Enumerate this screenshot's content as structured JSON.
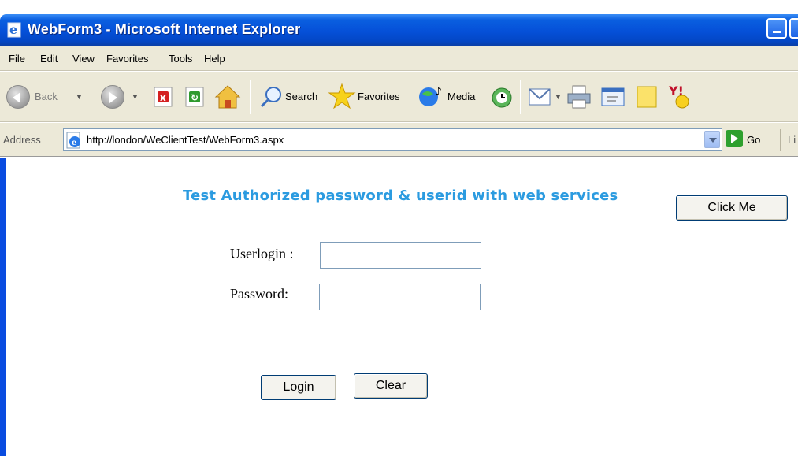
{
  "window": {
    "title": "WebForm3 - Microsoft Internet Explorer"
  },
  "menu": [
    "File",
    "Edit",
    "View",
    "Favorites",
    "Tools",
    "Help"
  ],
  "toolbar": {
    "back_label": "Back",
    "search_label": "Search",
    "favorites_label": "Favorites",
    "media_label": "Media"
  },
  "address": {
    "label": "Address",
    "url": "http://london/WeClientTest/WebForm3.aspx",
    "go_label": "Go",
    "links_label": "Li"
  },
  "page": {
    "heading": "Test Authorized password & userid with web services",
    "click_me_label": "Click Me",
    "userlogin_label": "Userlogin :",
    "userlogin_value": "",
    "password_label": "Password:",
    "password_value": "",
    "login_label": "Login",
    "clear_label": "Clear"
  },
  "colors": {
    "titlebar": "#0550d8",
    "heading": "#2b9be0",
    "chrome": "#ece9d8"
  }
}
